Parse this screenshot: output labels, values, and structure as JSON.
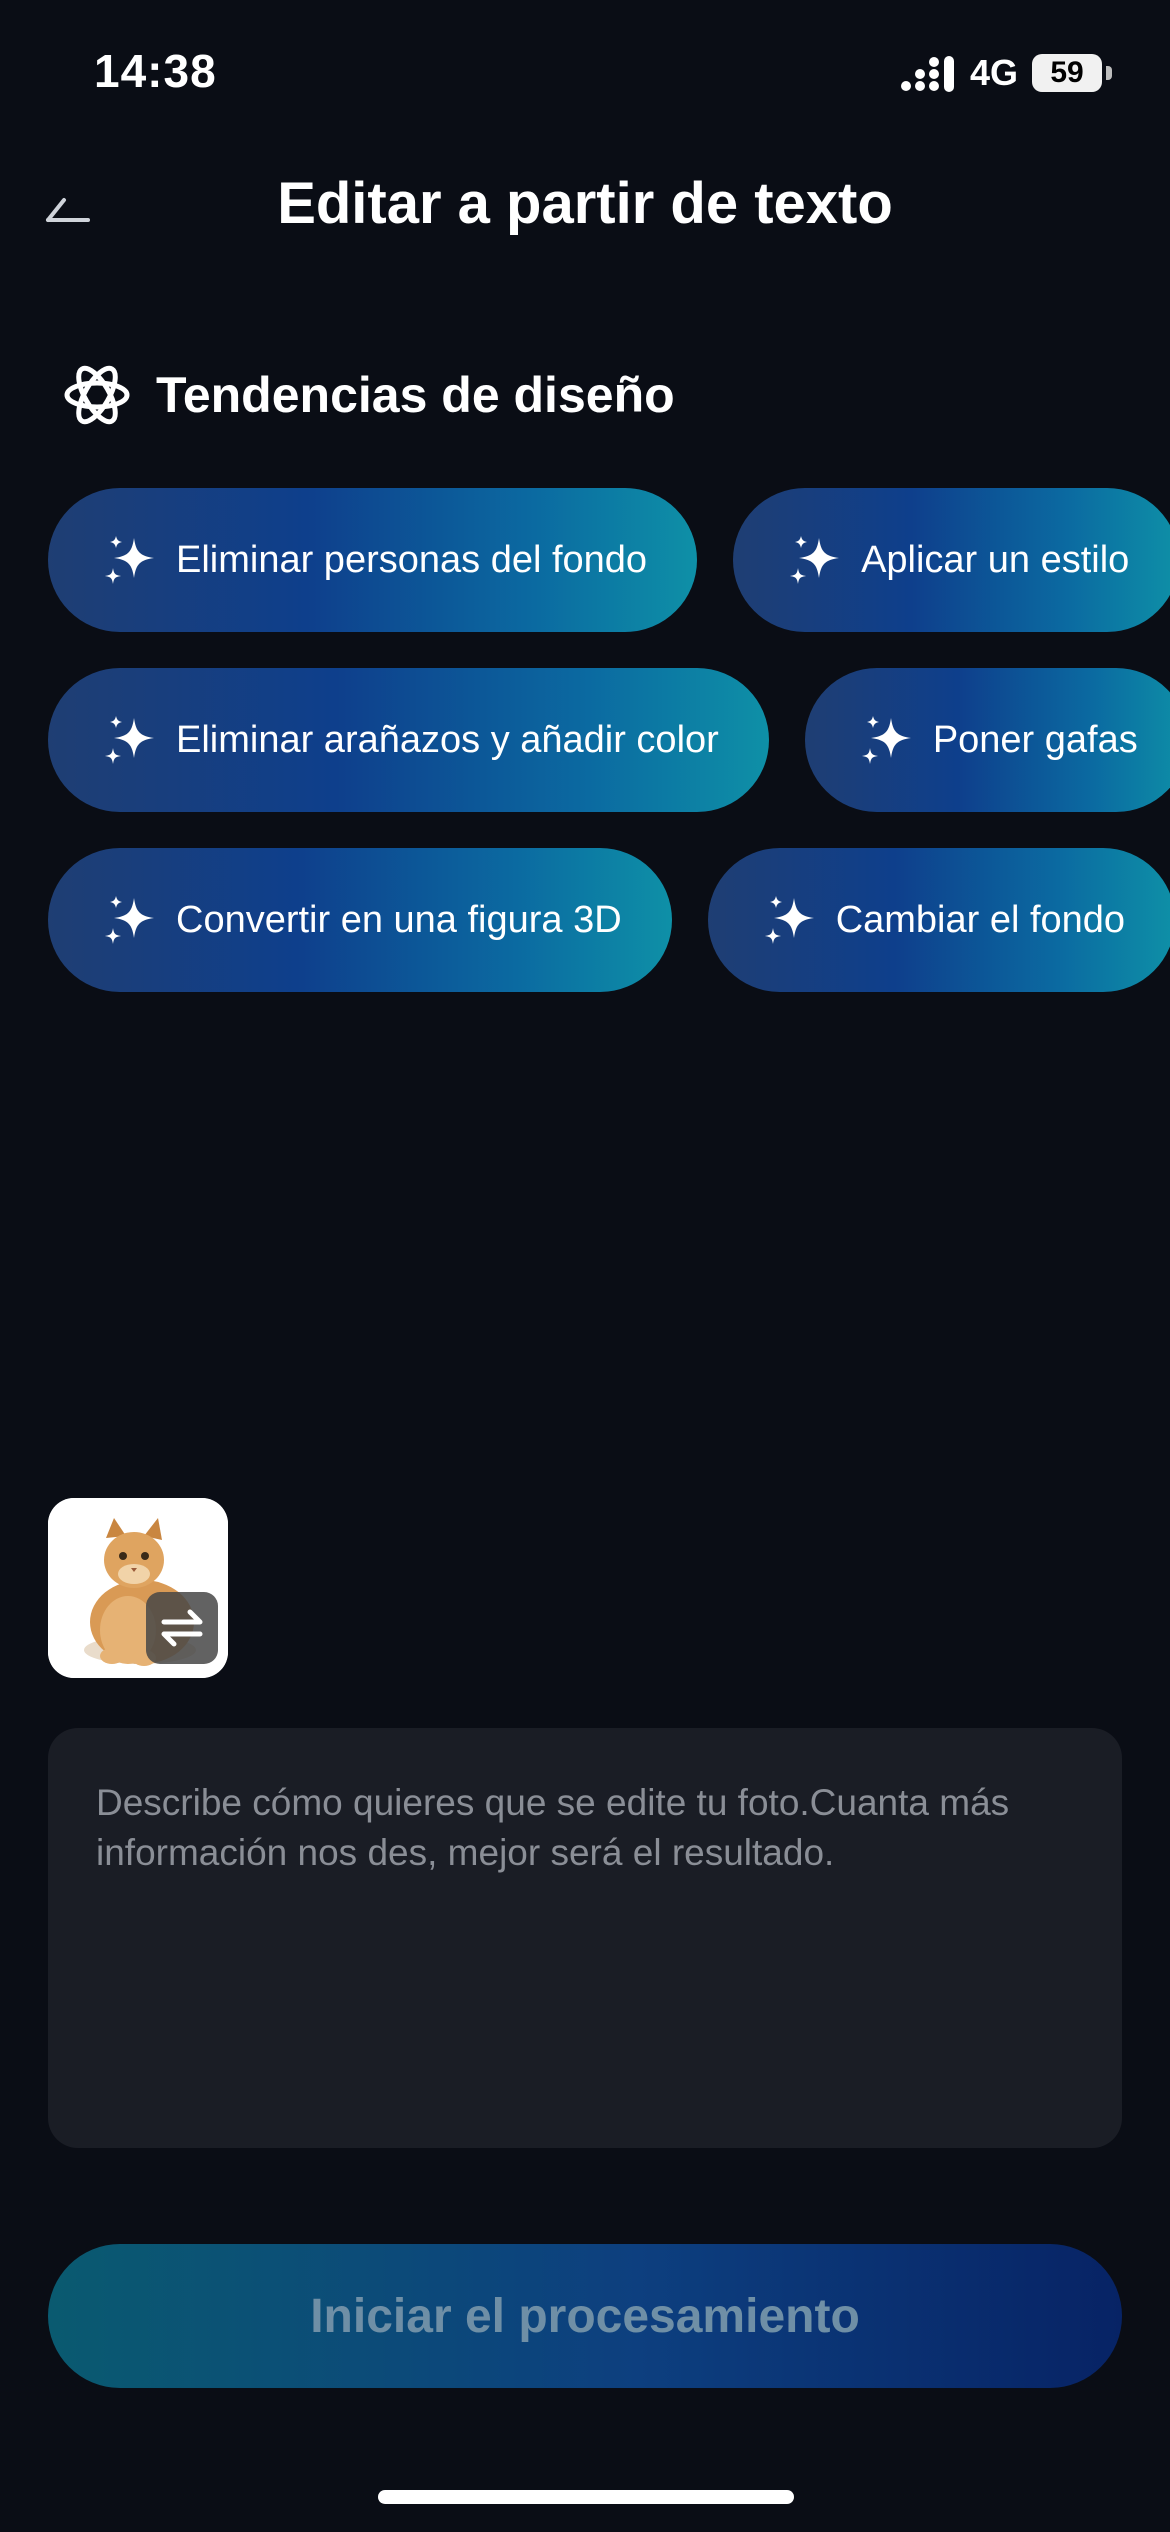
{
  "status_bar": {
    "time": "14:38",
    "network": "4G",
    "battery": "59"
  },
  "header": {
    "title": "Editar a partir de texto",
    "back_icon": "back-arrow-icon"
  },
  "trends": {
    "title": "Tendencias de diseño",
    "icon": "atom-icon",
    "rows": [
      [
        "Eliminar personas del fondo",
        "Aplicar un estilo"
      ],
      [
        "Eliminar arañazos y añadir color",
        "Poner gafas"
      ],
      [
        "Convertir en una figura 3D",
        "Cambiar el fondo"
      ]
    ]
  },
  "photo": {
    "subject": "cat",
    "swap_icon": "swap-icon"
  },
  "prompt": {
    "placeholder": "Describe cómo quieres que se edite tu foto.Cuanta más información nos des, mejor será el resultado.",
    "value": ""
  },
  "start_button": {
    "label": "Iniciar el procesamiento"
  },
  "colors": {
    "background": "#0a0d15",
    "chip_gradient_start": "#1f3e73",
    "chip_gradient_end": "#0e90a7",
    "button_gradient_start": "#0a5a70",
    "button_gradient_end": "#072365"
  }
}
